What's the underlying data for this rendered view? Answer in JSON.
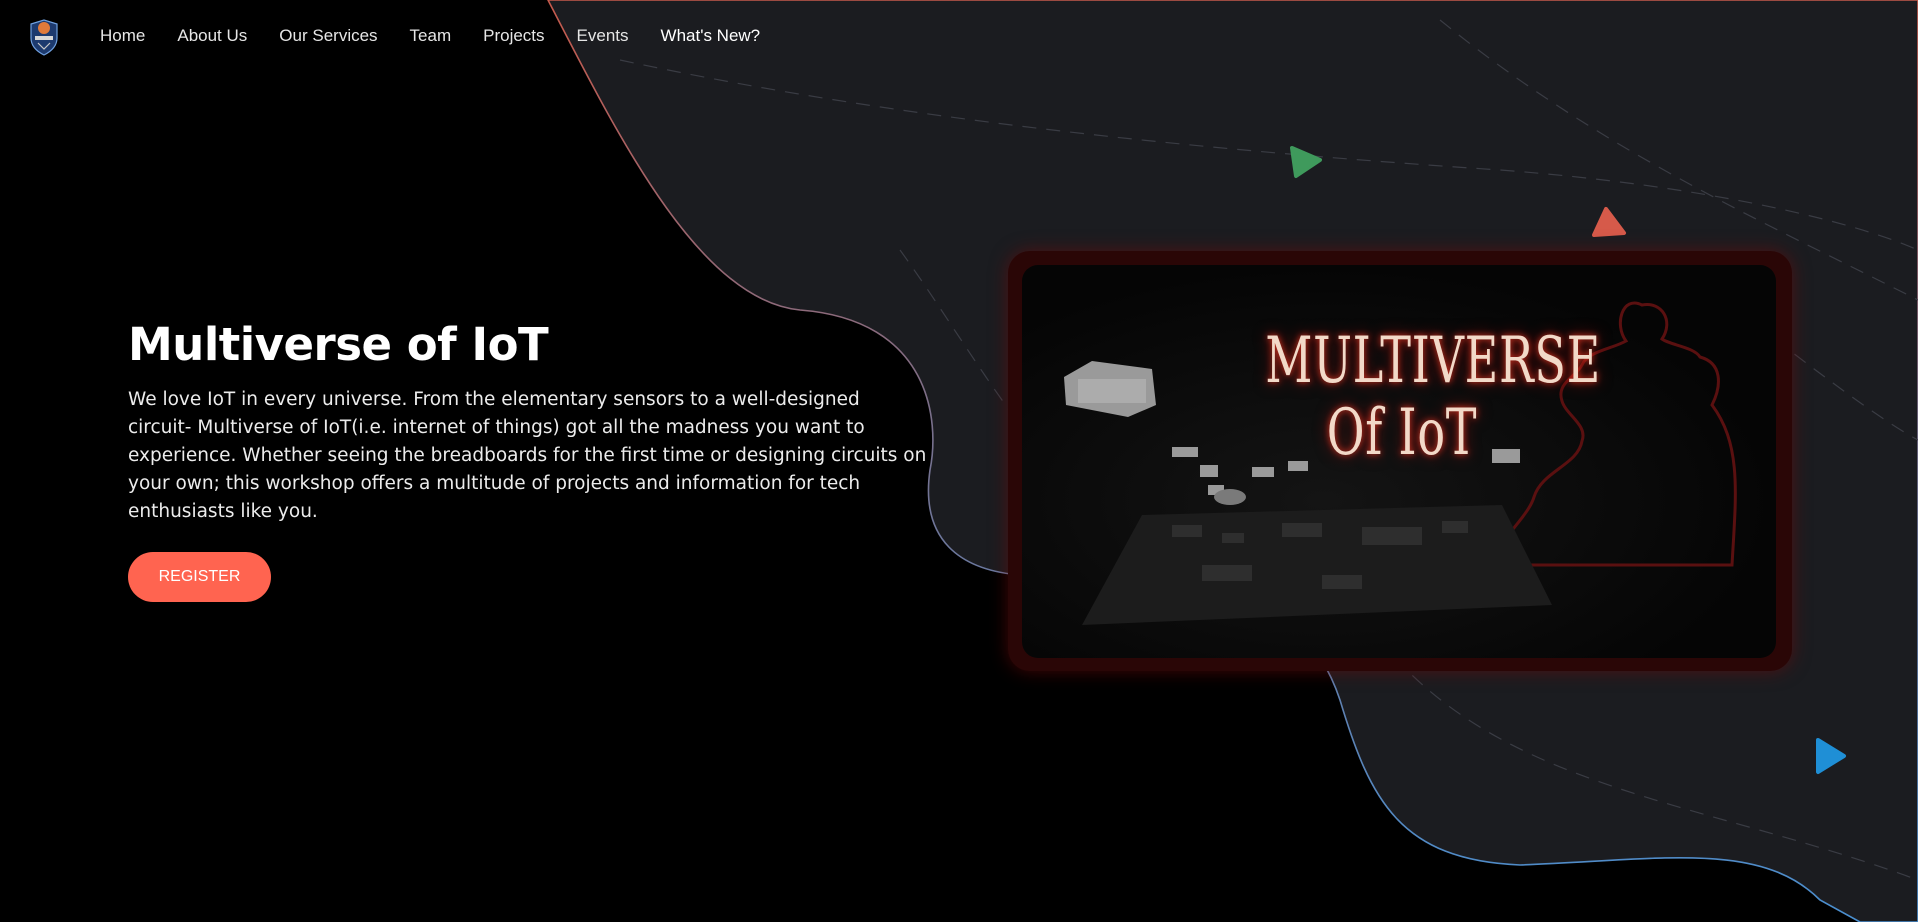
{
  "nav": {
    "items": [
      {
        "label": "Home"
      },
      {
        "label": "About Us"
      },
      {
        "label": "Our Services"
      },
      {
        "label": "Team"
      },
      {
        "label": "Projects"
      },
      {
        "label": "Events"
      },
      {
        "label": "What's New?"
      }
    ]
  },
  "hero": {
    "title": "Multiverse of IoT",
    "description": "We love IoT in every universe. From the elementary sensors to a well-designed circuit- Multiverse of IoT(i.e. internet of things) got all the madness you want to experience. Whether seeing the breadboards for the first time or designing circuits on your own; this workshop offers a multitude of projects and information for tech enthusiasts like you.",
    "register_label": "REGISTER"
  },
  "poster": {
    "line1": "MULTIVERSE",
    "line2": "Of IoT"
  },
  "colors": {
    "accent": "#ff6450",
    "blob": "#1b1c20",
    "triangle_green": "#3f9a5c",
    "triangle_red": "#d65a4a",
    "triangle_blue": "#1f8fd6"
  }
}
